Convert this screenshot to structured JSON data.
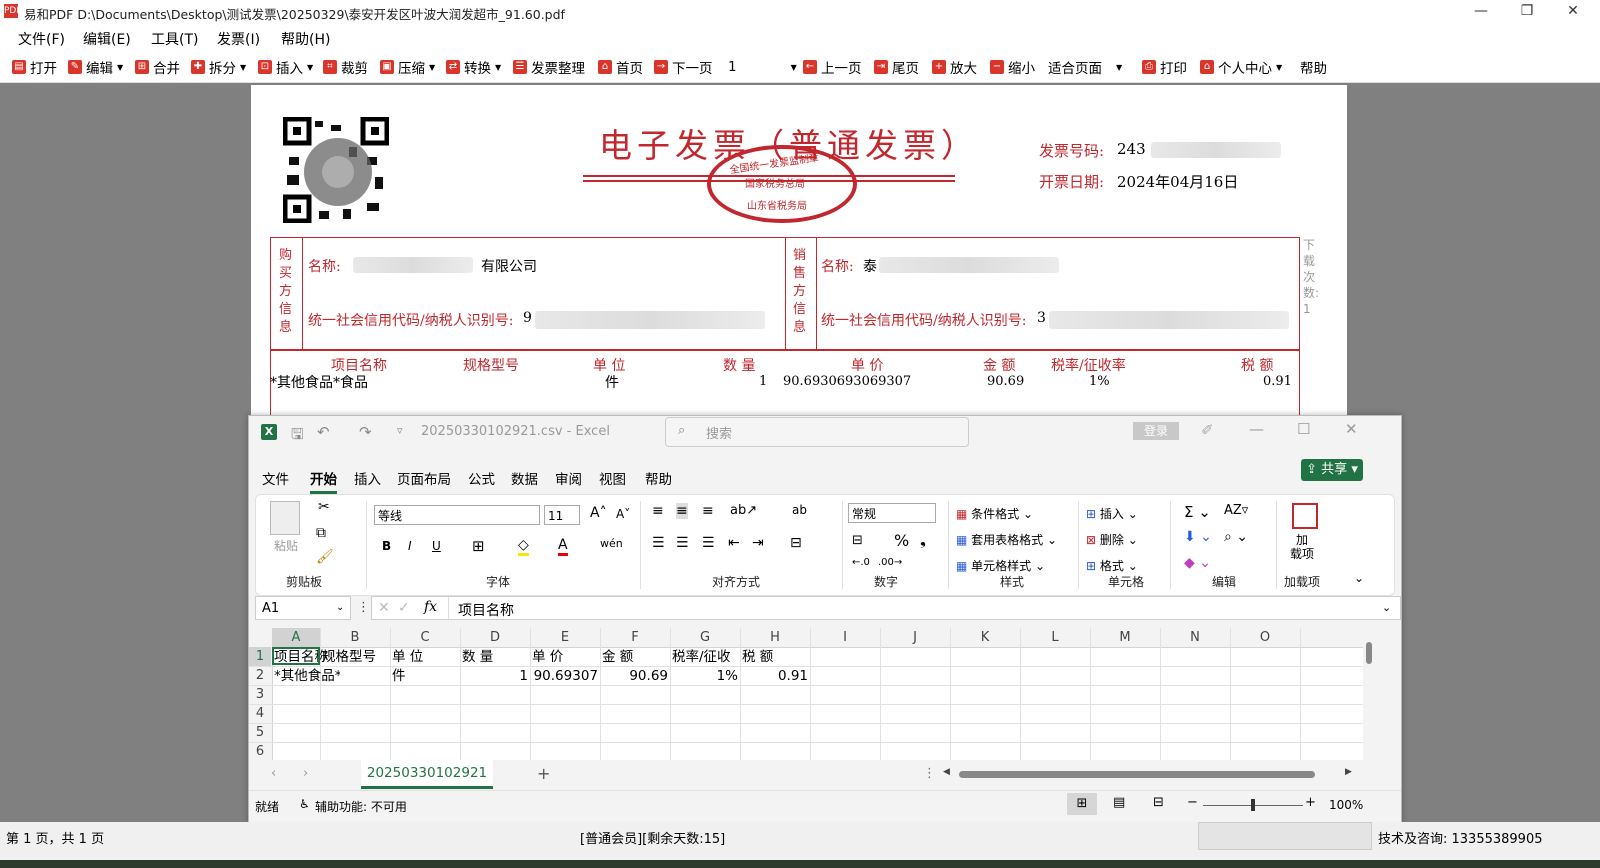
{
  "app": {
    "title": "易和PDF  D:\\Documents\\Desktop\\测试发票\\20250329\\泰安开发区叶波大润发超市_91.60.pdf",
    "logo": "PDF",
    "menu": [
      "文件(F)",
      "编辑(E)",
      "工具(T)",
      "发票(I)",
      "帮助(H)"
    ],
    "toolbar": {
      "open": "打开",
      "edit": "编辑",
      "merge": "合并",
      "split": "拆分",
      "insert": "插入",
      "crop": "裁剪",
      "compress": "压缩",
      "convert": "转换",
      "invoice_organize": "发票整理",
      "first": "首页",
      "next": "下一页",
      "page_value": "1",
      "prev": "上一页",
      "last": "尾页",
      "zoom_in": "放大",
      "zoom_out": "缩小",
      "fit": "适合页面",
      "print": "打印",
      "user_center": "个人中心",
      "help": "帮助"
    },
    "status": {
      "page": "第 1 页，共 1 页",
      "member": "[普通会员][剩余天数:15]",
      "support": "技术及咨询: 13355389905"
    }
  },
  "invoice": {
    "title": "电子发票（普通发票）",
    "invoice_no_label": "发票号码:",
    "invoice_no": "243",
    "date_label": "开票日期:",
    "date": "2024年04月16日",
    "seal_top": "全国统一发票监制章",
    "seal_mid": "国家税务总局",
    "seal_bottom": "山东省税务局",
    "buyer_side": "购买方信息",
    "seller_side": "销售方信息",
    "buyer_name_label": "名称:",
    "buyer_name_suffix": "有限公司",
    "buyer_tax_label": "统一社会信用代码/纳税人识别号:",
    "buyer_tax_prefix": "9",
    "seller_name_label": "名称:",
    "seller_name_prefix": "泰",
    "seller_tax_label": "统一社会信用代码/纳税人识别号:",
    "seller_tax_prefix": "3",
    "download_label": "下载次数: 1",
    "columns": [
      "项目名称",
      "规格型号",
      "单 位",
      "数 量",
      "单 价",
      "金 额",
      "税率/征收率",
      "税 额"
    ],
    "row": [
      "*其他食品*食品",
      "",
      "件",
      "1",
      "90.6930693069307",
      "90.69",
      "1%",
      "0.91"
    ]
  },
  "excel": {
    "title": "20250330102921.csv  -  Excel",
    "search": "搜索",
    "login": "登录",
    "tabs": [
      "文件",
      "开始",
      "插入",
      "页面布局",
      "公式",
      "数据",
      "审阅",
      "视图",
      "帮助"
    ],
    "share": "共享",
    "ribbon": {
      "paste": "粘贴",
      "clipboard": "剪贴板",
      "font_name": "等线",
      "font_size": "11",
      "font": "字体",
      "align": "对齐方式",
      "number_format": "常规",
      "number": "数字",
      "cond_format": "条件格式",
      "table_format": "套用表格格式",
      "cell_style": "单元格样式",
      "styles": "样式",
      "insert": "插入",
      "delete": "删除",
      "format": "格式",
      "cells": "单元格",
      "editing": "编辑",
      "addins": "加载项",
      "addins_btn": "加\n载项",
      "ab": "ab",
      "vdots": "⋮"
    },
    "namebox": "A1",
    "fx": "fx",
    "formula": "项目名称",
    "col_headers": [
      "A",
      "B",
      "C",
      "D",
      "E",
      "F",
      "G",
      "H",
      "I",
      "J",
      "K",
      "L",
      "M",
      "N",
      "O"
    ],
    "row_headers": [
      "1",
      "2",
      "3",
      "4",
      "5",
      "6"
    ],
    "rows": [
      [
        "项目名称",
        "规格型号",
        "单 位",
        "数 量",
        "单 价",
        "金 额",
        "税率/征收",
        "税 额"
      ],
      [
        "*其他食品*",
        "",
        "件",
        "1",
        "90.69307",
        "90.69",
        "1%",
        "0.91"
      ]
    ],
    "sheet_tab": "20250330102921",
    "status_ready": "就绪",
    "status_access": "辅助功能: 不可用",
    "zoom": "100%"
  },
  "colors": {
    "accent_red": "#c1272d",
    "excel_green": "#217346"
  }
}
